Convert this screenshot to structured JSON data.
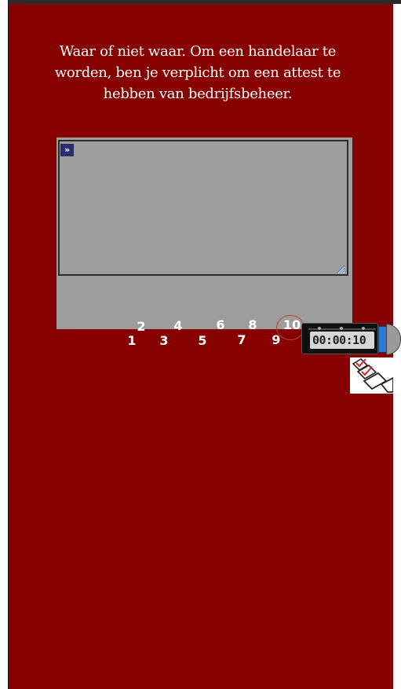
{
  "question": {
    "lines": [
      "Waar of niet waar. Om een handelaar te",
      "worden, ben je verplicht om een attest te",
      "hebben van bedrijfsbeheer."
    ]
  },
  "answer": {
    "value": "",
    "expand_icon": "double-chevron-right-icon",
    "expand_glyph": "»"
  },
  "navigation": {
    "questions": [
      "1",
      "2",
      "3",
      "4",
      "5",
      "6",
      "7",
      "8",
      "9",
      "10"
    ],
    "current": "10"
  },
  "timer": {
    "value": "00:00:10"
  },
  "check": {
    "icon": "checklist-icon"
  },
  "colors": {
    "background": "#860000",
    "panel": "#9d9d9d",
    "text": "#ffffff",
    "highlight_ring": "#b44a3a",
    "timer_accent": "#2a7ad8"
  }
}
